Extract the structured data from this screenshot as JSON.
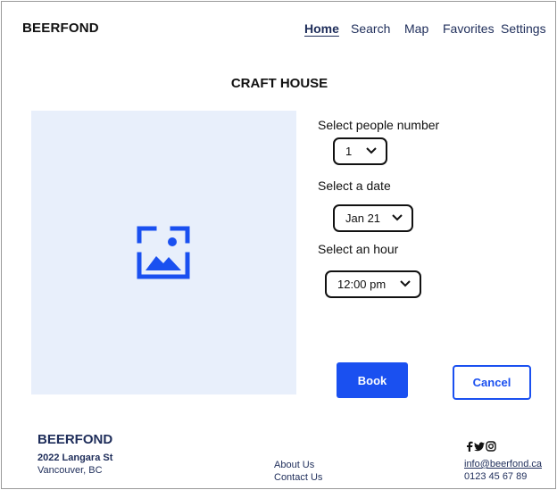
{
  "header": {
    "brand": "BEERFOND",
    "nav": [
      "Home",
      "Search",
      "Map",
      "Favorites",
      "Settings"
    ],
    "active_nav": "Home"
  },
  "page": {
    "title": "CRAFT HOUSE",
    "image_icon": "image-placeholder-icon"
  },
  "form": {
    "people_label": "Select people number",
    "people_value": "1",
    "date_label": "Select a date",
    "date_value": "Jan 21",
    "hour_label": "Select an hour",
    "hour_value": "12:00 pm"
  },
  "actions": {
    "book": "Book",
    "cancel": "Cancel"
  },
  "footer": {
    "brand": "BEERFOND",
    "street": "2022 Langara St",
    "city": "Vancouver, BC",
    "links": [
      "About Us",
      "Contact Us"
    ],
    "social_icons": [
      "facebook-icon",
      "twitter-icon",
      "instagram-icon"
    ],
    "email": "info@beerfond.ca",
    "phone": "0123 45 67 89"
  },
  "colors": {
    "accent": "#1a50f0",
    "navy": "#1e2d5a",
    "image_bg": "#e8effb"
  }
}
